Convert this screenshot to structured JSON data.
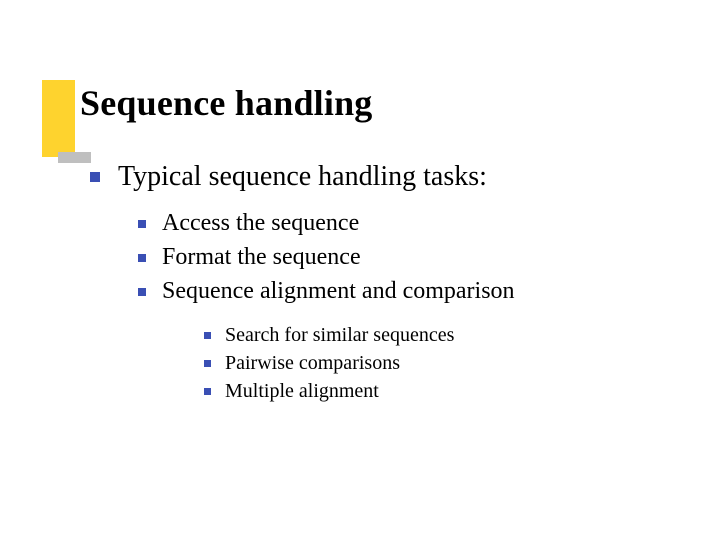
{
  "title": "Sequence handling",
  "level1": [
    "Typical sequence handling tasks:"
  ],
  "level2": [
    "Access the sequence",
    "Format the sequence",
    "Sequence alignment and comparison"
  ],
  "level3": [
    "Search for similar sequences",
    "Pairwise comparisons",
    "Multiple alignment"
  ],
  "colors": {
    "bullet": "#3a4fb4",
    "accent_yellow": "#fed32e",
    "accent_gray": "#bfbfbf"
  }
}
